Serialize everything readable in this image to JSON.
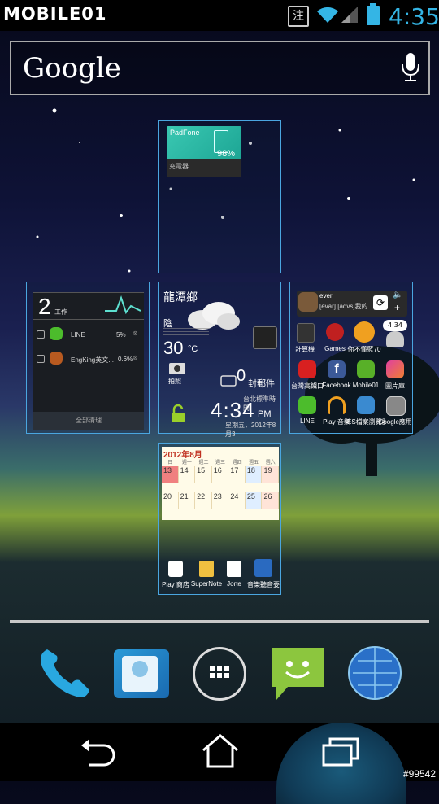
{
  "status_bar": {
    "brand": "MOBILE01",
    "carrier_badge": "注",
    "time": "4:35"
  },
  "search": {
    "logo": "Google"
  },
  "panel_top": {
    "device_name": "PadFone",
    "battery_percent": "98%",
    "status_label": "充電器"
  },
  "panel_left": {
    "count": "2",
    "count_label": "工作",
    "apps": [
      {
        "name": "LINE",
        "usage": "5%"
      },
      {
        "name": "EngKing英文...",
        "usage": "0.6%"
      }
    ],
    "clear_button": "全部清理"
  },
  "panel_center": {
    "location": "龍潭鄉",
    "condition": "陰",
    "temperature": "30",
    "temp_unit": "°C",
    "camera_label": "拍照",
    "mail_count": "0",
    "mail_label": "封郵件",
    "city": "台北標準時間",
    "time": "4:34",
    "ampm": "PM",
    "date": "星期五，2012年8月3"
  },
  "panel_right": {
    "music_artist": "ever",
    "music_track": "[evar] [advs]我的...",
    "apps": [
      {
        "name": "計算機",
        "icon": "calculator-icon"
      },
      {
        "name": "Games",
        "icon": "angry-birds-icon"
      },
      {
        "name": "你不懂藍70",
        "icon": "game-icon"
      },
      {
        "name": "",
        "icon": "clock-bubble-icon"
      },
      {
        "name": "台灣高鐵口",
        "icon": "apple-app-icon"
      },
      {
        "name": "Facebook",
        "icon": "facebook-icon"
      },
      {
        "name": "Mobile01",
        "icon": "mobile01-icon"
      },
      {
        "name": "圖片庫",
        "icon": "gallery-icon"
      },
      {
        "name": "LINE",
        "icon": "line-icon"
      },
      {
        "name": "Play 音樂",
        "icon": "headphones-icon"
      },
      {
        "name": "ES檔案瀏覽器",
        "icon": "es-file-icon"
      },
      {
        "name": "Google應用",
        "icon": "google-folder-icon"
      }
    ],
    "clock_badge": "4:34"
  },
  "panel_bottom": {
    "calendar_title": "2012年8月",
    "weekdays": [
      "日",
      "週一",
      "週二",
      "週三",
      "週四",
      "週五",
      "週六"
    ],
    "row1": [
      "13",
      "14",
      "15",
      "16",
      "17",
      "18",
      "19"
    ],
    "row2": [
      "20",
      "21",
      "22",
      "23",
      "24",
      "25",
      "26"
    ],
    "apps": [
      {
        "name": "Play 商店",
        "icon": "play-store-icon"
      },
      {
        "name": "SuperNote",
        "icon": "supernote-icon"
      },
      {
        "name": "Jorte",
        "icon": "jorte-icon"
      },
      {
        "name": "音樂聽音要",
        "icon": "music-app-icon"
      }
    ]
  },
  "watermark": "#99542",
  "colors": {
    "accent": "#34b5e5",
    "panel_border": "#4aa6e0",
    "mail_green": "#9ad02a"
  }
}
